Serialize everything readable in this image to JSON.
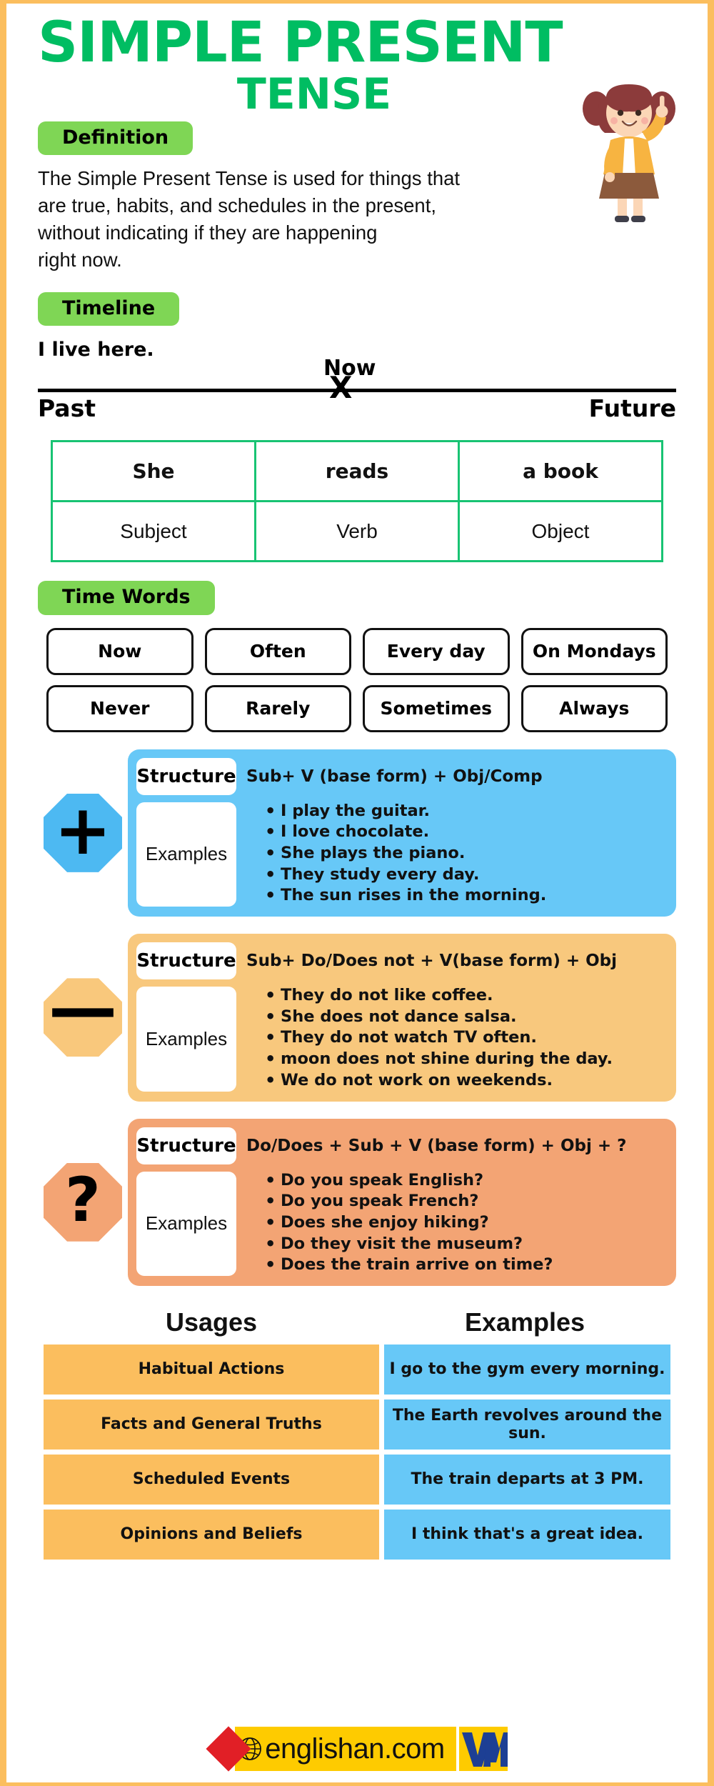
{
  "colors": {
    "frame": "#fbbe5e",
    "title_green": "#00bd62",
    "pill_green": "#7fd655",
    "table_border_green": "#18c373",
    "blue": "#67c8f7",
    "orange": "#f8c87d",
    "salmon": "#f3a474",
    "usage_orange": "#fbbe5e",
    "footer_yellow": "#fecb00",
    "footer_red": "#e11f26",
    "footer_navy": "#1d3f94"
  },
  "title": {
    "line1": "SIMPLE PRESENT",
    "line2": "TENSE"
  },
  "definition": {
    "pill_label": "Definition",
    "line1": "The Simple Present Tense is used for things that",
    "line2": "are true, habits, and schedules in the present,",
    "line3": "without indicating if they are happening",
    "line4": "right now."
  },
  "timeline": {
    "pill_label": "Timeline",
    "sentence": "I live here.",
    "now_label": "Now",
    "marker": "X",
    "past_label": "Past",
    "future_label": "Future"
  },
  "svo_table": {
    "example_row": [
      "She",
      "reads",
      "a book"
    ],
    "label_row": [
      "Subject",
      "Verb",
      "Object"
    ]
  },
  "time_words": {
    "pill_label": "Time Words",
    "chips": [
      "Now",
      "Often",
      "Every day",
      "On Mondays",
      "Never",
      "Rarely",
      "Sometimes",
      "Always"
    ]
  },
  "forms": [
    {
      "icon": "plus-icon",
      "glyph": "+",
      "structure_label": "Structure",
      "examples_label": "Examples",
      "structure_text": "Sub+ V (base form) + Obj/Comp",
      "examples": [
        "I play the guitar.",
        "I love chocolate.",
        "She plays the piano.",
        "They study every day.",
        "The sun rises in the morning."
      ]
    },
    {
      "icon": "minus-icon",
      "glyph": "—",
      "structure_label": "Structure",
      "examples_label": "Examples",
      "structure_text": "Sub+ Do/Does not + V(base form) + Obj",
      "examples": [
        "They do not like coffee.",
        "She does not dance salsa.",
        "They do not watch TV often.",
        "moon does not shine during the day.",
        "We do not work on weekends."
      ]
    },
    {
      "icon": "question-mark-icon",
      "glyph": "?",
      "structure_label": "Structure",
      "examples_label": "Examples",
      "structure_text": "Do/Does + Sub + V (base form) + Obj + ?",
      "examples": [
        "Do you speak English?",
        "Do you speak French?",
        "Does she enjoy hiking?",
        "Do they visit the museum?",
        "Does the train arrive on time?"
      ]
    }
  ],
  "usages": {
    "header_left": "Usages",
    "header_right": "Examples",
    "rows": [
      {
        "usage": "Habitual Actions",
        "example": "I go to the gym every morning."
      },
      {
        "usage": "Facts and General Truths",
        "example": "The Earth revolves around the sun."
      },
      {
        "usage": "Scheduled Events",
        "example": "The train departs at 3 PM."
      },
      {
        "usage": "Opinions and Beliefs",
        "example": "I think that's a great idea."
      }
    ]
  },
  "footer": {
    "brand": "englishan.com"
  }
}
